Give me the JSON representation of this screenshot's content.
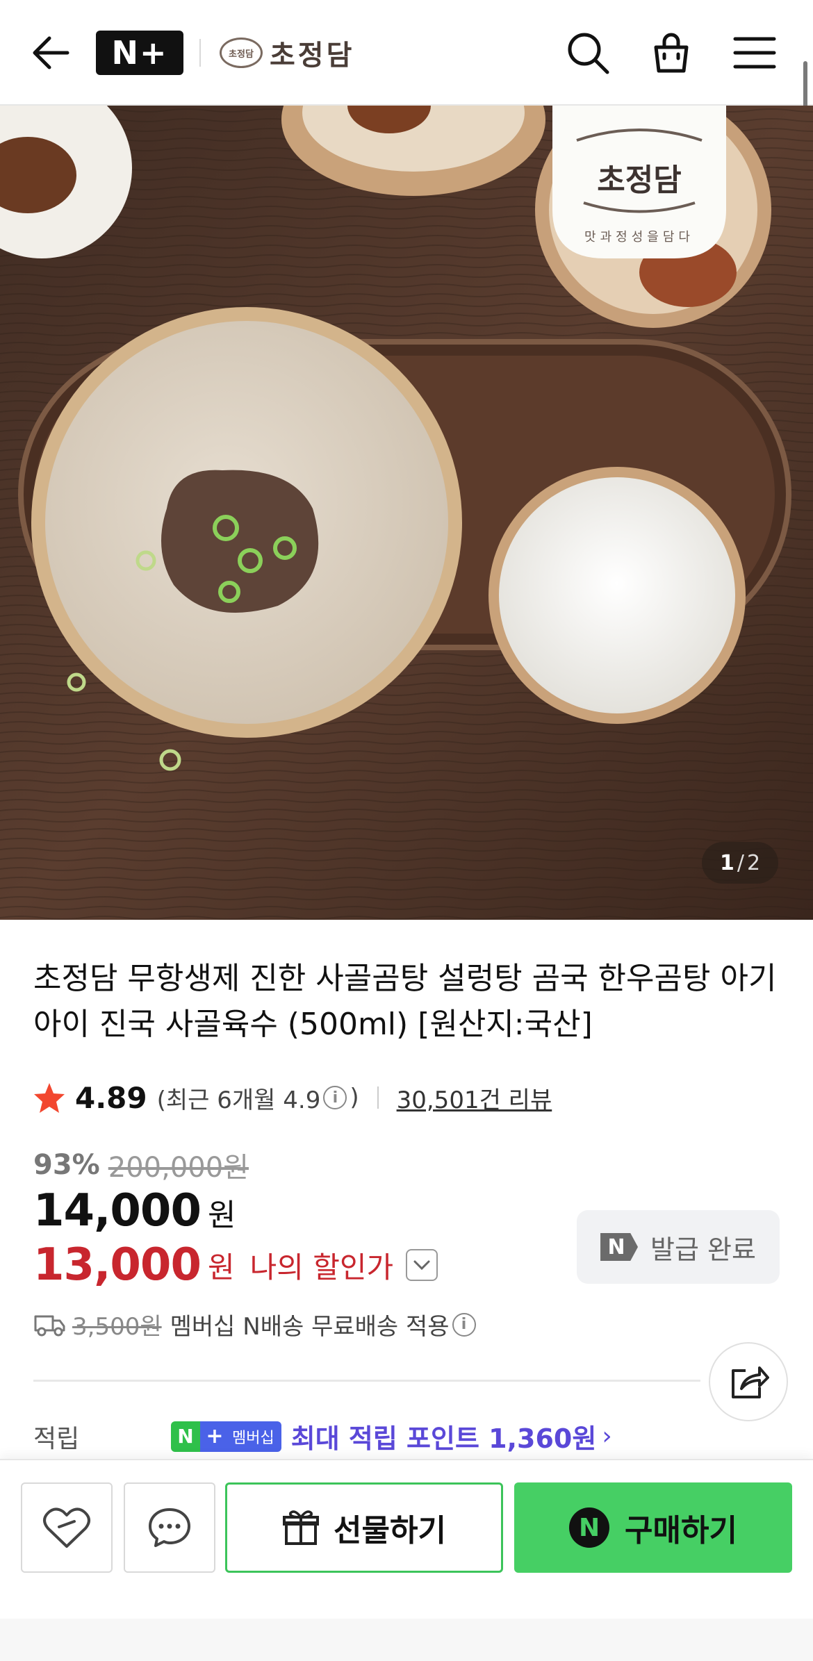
{
  "header": {
    "nplus_logo": "N+",
    "brand_badge": "초정담",
    "brand_name": "초정담",
    "icons": [
      "back-arrow-icon",
      "search-icon",
      "cart-icon",
      "menu-icon"
    ]
  },
  "hero": {
    "counter_current": "1",
    "counter_separator": "/",
    "counter_total": "2",
    "package_brand": "초정담",
    "package_tagline": "맛과정성을담다"
  },
  "product": {
    "title": "초정담 무항생제 진한 사골곰탕 설렁탕 곰국 한우곰탕 아기 아이 진국 사골육수 (500ml) [원산지:국산]",
    "rating": "4.89",
    "recent_rating_prefix": "(최근 6개월 4.9",
    "recent_rating_suffix": ")",
    "review_count": "30,501건 리뷰",
    "discount_percent": "93%",
    "original_price": "200,000원",
    "price": "14,000",
    "price_unit": "원",
    "my_price": "13,000",
    "my_price_unit": "원",
    "my_price_label": "나의 할인가",
    "coupon_label": "발급 완료",
    "coupon_badge": "N",
    "shipping_original": "3,500원",
    "shipping_text": "멤버십 N배송 무료배송 적용",
    "points_label": "적립",
    "membership_badge_n": "N",
    "membership_badge_plus": "+",
    "membership_badge_text": "멤버십",
    "points_text": "최대 적립 포인트 1,360원",
    "points_chevron": "›"
  },
  "actions": {
    "gift_label": "선물하기",
    "buy_badge": "N",
    "buy_label": "구매하기"
  },
  "colors": {
    "sale_red": "#c8262e",
    "buy_green": "#46cf64",
    "points_purple": "#5a48d8",
    "membership_blue": "#4a62e8"
  }
}
